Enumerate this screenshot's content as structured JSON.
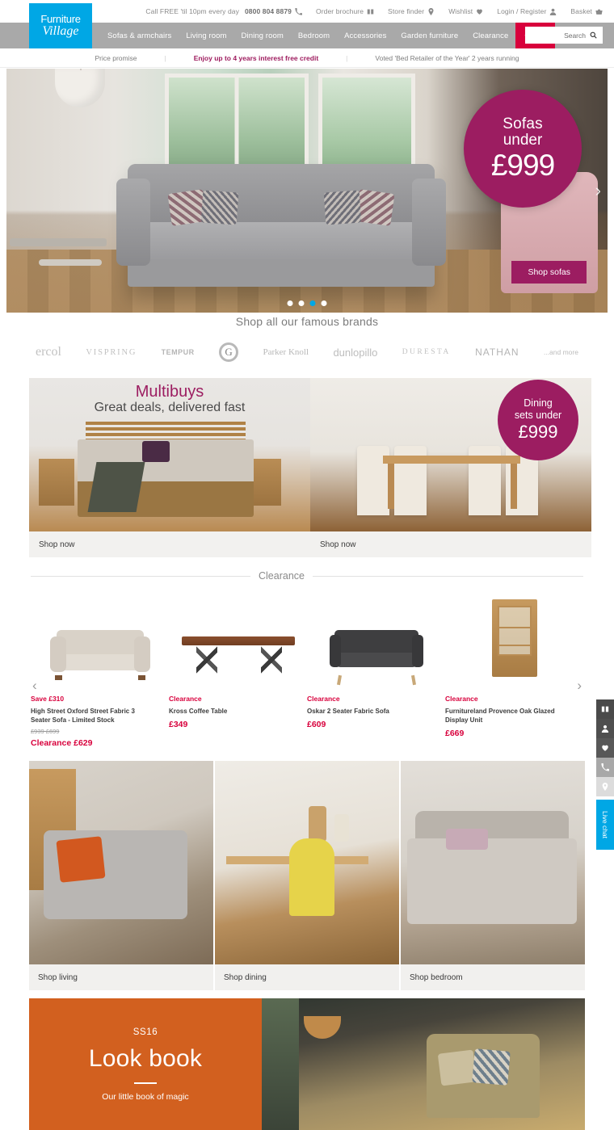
{
  "utility": {
    "phone_text": "Call FREE 'til 10pm every day",
    "phone_number": "0800 804 8879",
    "items": [
      {
        "label": "Order brochure",
        "icon": "brochure-icon"
      },
      {
        "label": "Store finder",
        "icon": "location-pin-icon"
      },
      {
        "label": "Wishlist",
        "icon": "heart-icon"
      },
      {
        "label": "Login / Register",
        "icon": "user-icon"
      },
      {
        "label": "Basket",
        "icon": "basket-icon"
      }
    ]
  },
  "logo": {
    "line1": "Furniture",
    "line2": "Village",
    "color": "#00a7e5"
  },
  "nav": {
    "items": [
      {
        "label": "Sofas & armchairs",
        "highlight": false
      },
      {
        "label": "Living room",
        "highlight": false
      },
      {
        "label": "Dining room",
        "highlight": false
      },
      {
        "label": "Bedroom",
        "highlight": false
      },
      {
        "label": "Accessories",
        "highlight": false
      },
      {
        "label": "Garden furniture",
        "highlight": false
      },
      {
        "label": "Clearance",
        "highlight": false
      },
      {
        "label": "Offers",
        "highlight": true
      }
    ],
    "offers_color": "#d8003c",
    "bar_color": "#a9a9a9"
  },
  "search": {
    "placeholder": "Search",
    "value": "",
    "label": "Search"
  },
  "promo_strip": {
    "left": "Price promise",
    "middle": "Enjoy up to 4 years interest free credit",
    "right": "Voted 'Bed Retailer of the Year' 2 years running",
    "middle_color": "#9e1b5e"
  },
  "hero": {
    "badge_line1": "Sofas",
    "badge_line2": "under",
    "badge_line3": "£999",
    "cta": "Shop sofas",
    "badge_color": "#9c1d61",
    "dots_total": 4,
    "dots_active_index": 3,
    "active_dot_color": "#00a7e5"
  },
  "brands": {
    "title": "Shop all our famous brands",
    "items": [
      {
        "name": "ercol"
      },
      {
        "name": "VISPRING"
      },
      {
        "name": "TEMPUR"
      },
      {
        "name": "G"
      },
      {
        "name": "Parker Knoll"
      },
      {
        "name": "dunlopillo"
      },
      {
        "name": "DURESTA"
      },
      {
        "name": "NATHAN"
      },
      {
        "name": "...and more"
      }
    ]
  },
  "panels": {
    "left": {
      "title": "Multibuys",
      "subtitle": "Great deals, delivered fast",
      "cta": "Shop now"
    },
    "right": {
      "badge_line1": "Dining",
      "badge_line2": "sets under",
      "badge_line3": "£999",
      "cta": "Shop now"
    }
  },
  "clearance": {
    "heading": "Clearance",
    "prev_arrow": "‹",
    "next_arrow": "›",
    "products": [
      {
        "tag": "Save £310",
        "name": "High Street Oxford Street Fabric 3 Seater Sofa - Limited Stock",
        "old_price": "£939 £699",
        "price": "Clearance £629"
      },
      {
        "tag": "Clearance",
        "name": "Kross Coffee Table",
        "old_price": "",
        "price": "£349"
      },
      {
        "tag": "Clearance",
        "name": "Oskar 2 Seater Fabric Sofa",
        "old_price": "",
        "price": "£609"
      },
      {
        "tag": "Clearance",
        "name": "Furnitureland Provence Oak Glazed Display Unit",
        "old_price": "",
        "price": "£669"
      }
    ]
  },
  "tiles": [
    {
      "label": "Shop living"
    },
    {
      "label": "Shop dining"
    },
    {
      "label": "Shop bedroom"
    }
  ],
  "lookbook": {
    "season": "SS16",
    "title": "Look book",
    "subtitle": "Our little book of magic",
    "bg_color": "#d2601f"
  },
  "rail": {
    "buttons": [
      {
        "icon": "brochure-icon"
      },
      {
        "icon": "user-icon"
      },
      {
        "icon": "heart-icon"
      },
      {
        "icon": "phone-icon"
      },
      {
        "icon": "location-pin-icon"
      }
    ],
    "live_chat": "Live chat",
    "live_chat_color": "#00a7e5"
  }
}
